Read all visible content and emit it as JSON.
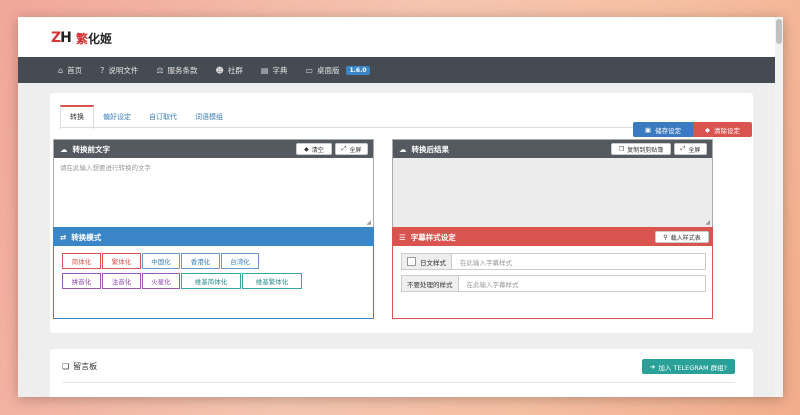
{
  "site": {
    "logo_mark_1": "Z",
    "logo_mark_2": "H",
    "logo_title_1": "繁",
    "logo_title_2": "化姬"
  },
  "nav": {
    "home": "首页",
    "docs": "说明文件",
    "terms": "服务条款",
    "community": "社群",
    "dict": "字典",
    "desktop": "桌面版",
    "version": "1.6.0"
  },
  "tabs": [
    "转换",
    "偏好设定",
    "自订取代",
    "词语模组"
  ],
  "actions": {
    "save_settings": "储存设定",
    "clear_settings": "清除设定"
  },
  "input_panel": {
    "title": "转换前文字",
    "clear": "清空",
    "fullscreen": "全屏",
    "placeholder": "请在此输入想要进行转换的文字"
  },
  "output_panel": {
    "title": "转换后结果",
    "copy": "复制到剪贴簿",
    "fullscreen": "全屏"
  },
  "mode_panel": {
    "title": "转换模式",
    "row1": [
      "简体化",
      "繁体化",
      "中国化",
      "香港化",
      "台湾化"
    ],
    "row2": [
      "拼音化",
      "注音化",
      "火星化",
      "维基简体化",
      "维基繁体化"
    ]
  },
  "subtitle_panel": {
    "title": "字幕样式设定",
    "load_button": "载入样式表",
    "row1_label": "日文样式",
    "row1_placeholder": "在此输入字幕样式",
    "row2_label": "不要处理的样式",
    "row2_placeholder": "在此输入字幕样式"
  },
  "message_board": {
    "title": "留言板",
    "telegram_button": "加入 TELEGRAM 群组?"
  }
}
